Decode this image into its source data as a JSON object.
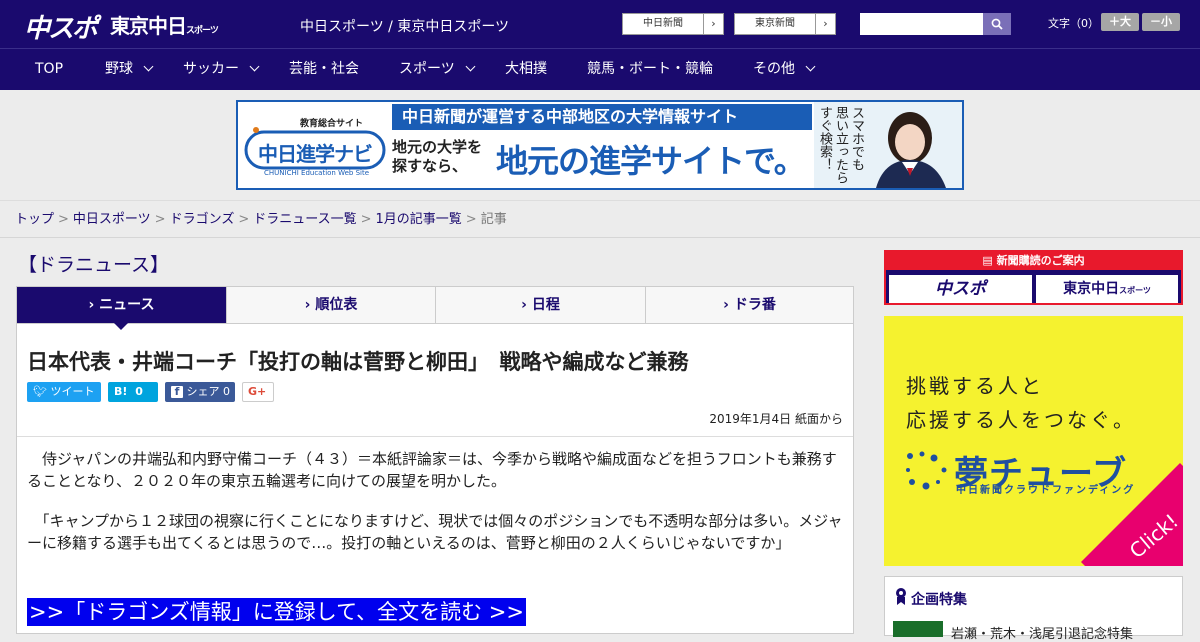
{
  "header": {
    "logo_chunichi": "中スポ",
    "logo_tokyo": "東京中日",
    "logo_tokyo_small": "スポーツ",
    "sites_text": "中日スポーツ / 東京中日スポーツ",
    "ext_links": [
      "中日新聞",
      "東京新聞"
    ],
    "search_placeholder": "",
    "fontsize_label": "文字（0）",
    "font_larger": "＋大",
    "font_smaller": "－小"
  },
  "nav": {
    "items": [
      "TOP",
      "野球",
      "サッカー",
      "芸能・社会",
      "スポーツ",
      "大相撲",
      "競馬・ボート・競輪",
      "その他"
    ]
  },
  "banner": {
    "logo_top": "教育総合サイト",
    "logo_main": "中日進学ナビ",
    "logo_en": "CHUNICHI Education Web Site",
    "headline": "中日新聞が運営する中部地区の大学情報サイト",
    "sub1": "地元の大学を",
    "sub2": "探すなら、",
    "main": "地元の進学サイトで。",
    "vertical": "スマホでも 思い立ったら すぐ検索！"
  },
  "breadcrumb": {
    "items": [
      "トップ",
      "中日スポーツ",
      "ドラゴンズ",
      "ドラニュース一覧",
      "1月の記事一覧"
    ],
    "current": "記事"
  },
  "section_title": "【ドラニュース】",
  "tabs": [
    "ニュース",
    "順位表",
    "日程",
    "ドラ番"
  ],
  "article": {
    "headline": "日本代表・井端コーチ「投打の軸は菅野と柳田」　戦略や編成など兼務",
    "share": {
      "tweet": "ツイート",
      "hatena": "B!",
      "hatena_count": "0",
      "facebook": "シェア",
      "facebook_count": "0",
      "gplus": "G+"
    },
    "date": "2019年1月4日 紙面から",
    "paragraphs": [
      "　侍ジャパンの井端弘和内野守備コーチ（４３）＝本紙評論家＝は、今季から戦略や編成面などを担うフロントも兼務することとなり、２０２０年の東京五輪選考に向けての展望を明かした。",
      "　「キャンプから１２球団の視察に行くことになりますけど、現状では個々のポジションでも不透明な部分は多い。メジャーに移籍する選手も出てくるとは思うので…。投打の軸といえるのは、菅野と柳田の２人くらいじゃないですか」"
    ],
    "read_more": ">>「ドラゴンズ情報」に登録して、全文を読む >>"
  },
  "sidebar": {
    "subscribe_header": "新聞購読のご案内",
    "subscribe_logos": [
      "中スポ",
      "東京中日"
    ],
    "subscribe_logo_small": "スポーツ",
    "ad_line1": "挑戦する人と",
    "ad_line2": "応援する人をつなぐ。",
    "ad_brand": "夢チューブ",
    "ad_brand_sub": "中日新聞クラウドファンディング",
    "ad_click": "Click!",
    "special_title": "企画特集",
    "special_item": "岩瀬・荒木・浅尾引退記念特集"
  },
  "colors": {
    "navy": "#1a0a6e",
    "link_blue": "#0000ee",
    "banner_blue": "#1a5db5",
    "ad_yellow": "#f5f22f",
    "accent_red": "#e8192c"
  }
}
